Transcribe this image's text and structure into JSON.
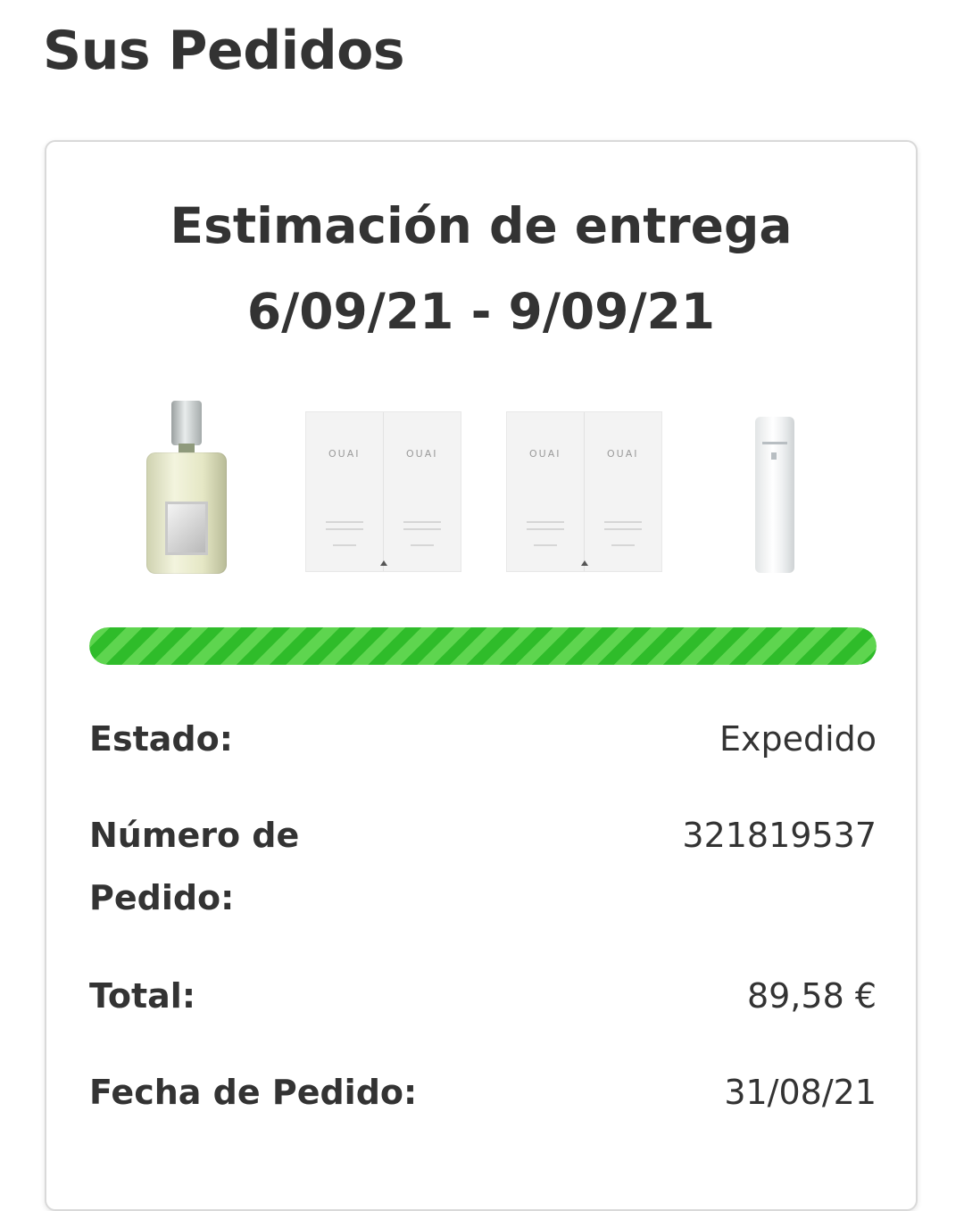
{
  "page": {
    "title": "Sus Pedidos"
  },
  "order_card": {
    "delivery_title": "Estimación de entrega",
    "delivery_range": "6/09/21 - 9/09/21",
    "products": [
      {
        "name": "perfume-bottle"
      },
      {
        "name": "ouai-sachet-pair",
        "brand": "OUAI"
      },
      {
        "name": "ouai-sachet-pair",
        "brand": "OUAI"
      },
      {
        "name": "spray-bottle"
      }
    ],
    "progress": {
      "fraction": 1.0,
      "color": "#2fbc2a"
    },
    "details": {
      "status_label": "Estado:",
      "status_value": "Expedido",
      "order_number_label": "Número de Pedido:",
      "order_number_value": "321819537",
      "total_label": "Total:",
      "total_value": "89,58 €",
      "order_date_label": "Fecha de Pedido:",
      "order_date_value": "31/08/21"
    }
  }
}
